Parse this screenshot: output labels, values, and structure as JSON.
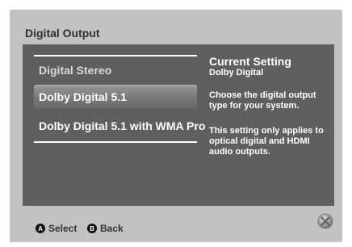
{
  "screen": {
    "title": "Digital Output"
  },
  "options": [
    {
      "label": "Digital Stereo"
    },
    {
      "label": "Dolby Digital 5.1"
    },
    {
      "label": "Dolby Digital 5.1 with WMA Pro"
    }
  ],
  "info": {
    "heading": "Current Setting",
    "current": "Dolby Digital",
    "description": "Choose the digital output type for your system.",
    "note": "This setting only applies to optical digital and HDMI audio outputs."
  },
  "footer": {
    "select_glyph": "A",
    "select_label": "Select",
    "back_glyph": "B",
    "back_label": "Back",
    "guide_icon": "xbox-guide-icon"
  },
  "colors": {
    "frame": "#c2c2c2",
    "panel": "#5f5f5f",
    "highlight": "#8a8a8a"
  }
}
